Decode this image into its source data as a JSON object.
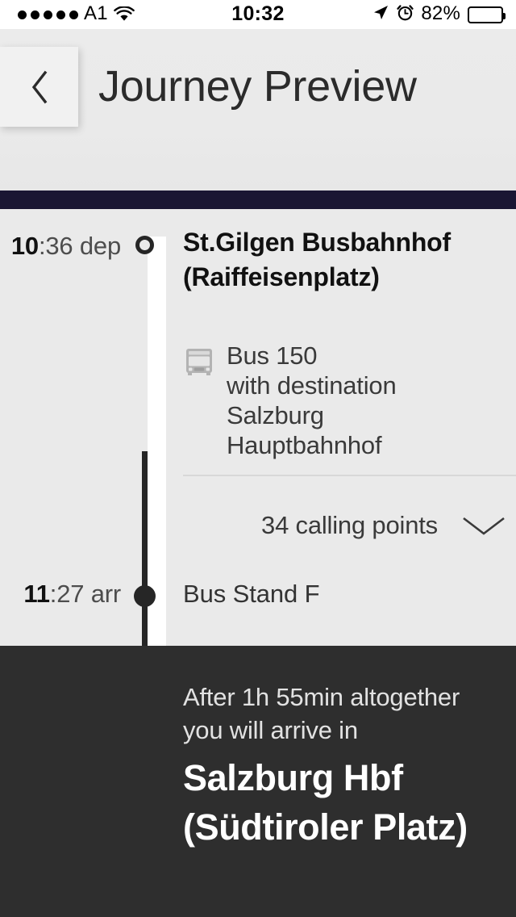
{
  "status_bar": {
    "signal_dots": 5,
    "carrier": "A1",
    "wifi_icon": "wifi-icon",
    "time": "10:32",
    "location_icon": "location-arrow-icon",
    "alarm_icon": "alarm-clock-icon",
    "battery_percent": "82%",
    "battery_level": 82
  },
  "header": {
    "back_icon": "chevron-left-icon",
    "title": "Journey Preview"
  },
  "journey": {
    "departure": {
      "time_hour": "10",
      "time_rest": ":36 dep",
      "stop_name": "St.Gilgen Busbahnhof (Raiffeisenplatz)",
      "marker": "hollow-circle-marker"
    },
    "service": {
      "icon": "bus-icon",
      "line": "Bus 150",
      "destination_prefix": "with destination",
      "destination": "Salzburg Hauptbahnhof"
    },
    "calling_points": {
      "label": "34 calling points",
      "count": 34,
      "expander_icon": "chevron-down-icon"
    },
    "arrival": {
      "time_hour": "11",
      "time_rest": ":27 arr",
      "stand": "Bus Stand F",
      "marker": "filled-circle-marker"
    }
  },
  "arrival_panel": {
    "summary": "After 1h 55min altogether you will arrive in",
    "duration": "1h 55min",
    "destination": "Salzburg Hbf (Südtiroler Platz)"
  },
  "colors": {
    "accent_navy": "#1a1633",
    "panel_dark": "#2e2e2e",
    "content_bg": "#eaeaea",
    "header_bg": "#eaeaea"
  }
}
